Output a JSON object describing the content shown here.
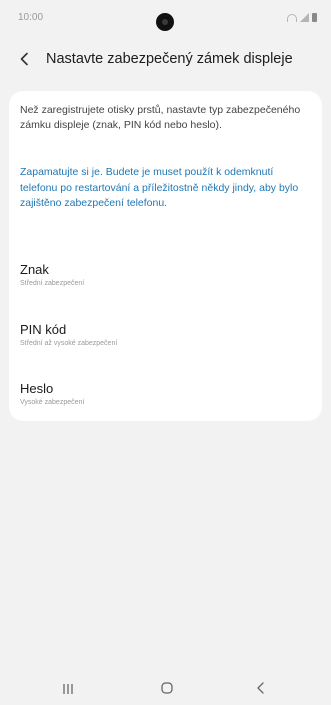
{
  "status_bar": {
    "time": "10:00",
    "icons": [
      "wifi-icon",
      "signal-icon",
      "battery-icon"
    ]
  },
  "header": {
    "back_icon": "back-arrow-icon",
    "title": "Nastavte zabezpečený zámek displeje"
  },
  "card": {
    "info_text": "Než zaregistrujete otisky prstů, nastavte typ zabezpečeného zámku displeje (znak, PIN kód nebo heslo).",
    "note_text": "Zapamatujte si je. Budete je muset použít k odemknutí telefonu po restartování a příležitostně někdy jindy, aby bylo zajištěno zabezpečení telefonu.",
    "note_color": "#1f77b4",
    "options": [
      {
        "title": "Znak",
        "subtitle": "Střední zabezpečení"
      },
      {
        "title": "PIN kód",
        "subtitle": "Střední až vysoké zabezpečení"
      },
      {
        "title": "Heslo",
        "subtitle": "Vysoké zabezpečení"
      }
    ]
  },
  "nav_bar": {
    "icons": [
      "recent-apps-icon",
      "home-icon",
      "back-icon"
    ]
  },
  "colors": {
    "background": "#f2f2f2",
    "card": "#ffffff",
    "accent": "#1f77b4"
  }
}
